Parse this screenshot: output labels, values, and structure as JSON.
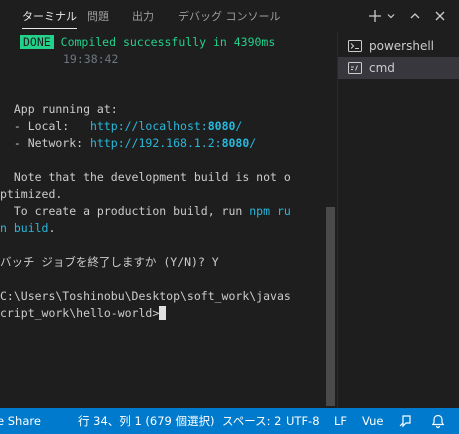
{
  "tabs": [
    {
      "label": "ターミナル",
      "active": true
    },
    {
      "label": "問題"
    },
    {
      "label": "出力"
    },
    {
      "label": "デバッグ コンソール"
    }
  ],
  "toolbar_icons": [
    "plus-icon",
    "chevron-down-icon",
    "chevron-up-icon",
    "close-icon"
  ],
  "terminal": {
    "done_badge": "DONE",
    "compiled_message": "Compiled successfully in 4390ms",
    "time": "19:38:42",
    "app_running": "  App running at:",
    "local_prefix": "  - Local:   ",
    "local_url": "http://localhost:",
    "local_port": "8080",
    "local_suffix": "/",
    "network_prefix": "  - Network: ",
    "network_url": "http://192.168.1.2:",
    "network_port": "8080",
    "network_suffix": "/",
    "note_line1": "  Note that the development build is not o",
    "note_line2": "ptimized.",
    "build_prefix": "  To create a production build, run ",
    "npm_run_1": "npm ru",
    "npm_run_2": "n build",
    "build_suffix": ".",
    "batch_prompt": "バッチ ジョブを終了しますか (Y/N)? Y",
    "path_line1": "C:\\Users\\Toshinobu\\Desktop\\soft_work\\javas",
    "path_line2": "cript_work\\hello-world>"
  },
  "terminals_list": [
    {
      "label": "powershell",
      "icon": "powershell-icon",
      "selected": false
    },
    {
      "label": "cmd",
      "icon": "cmd-icon",
      "selected": true
    }
  ],
  "status_bar": {
    "live_share": "e Share",
    "cursor_position": "行 34、列 1 (679 個選択)",
    "spaces": "スペース: 2",
    "encoding": "UTF-8",
    "eol": "LF",
    "language": "Vue"
  },
  "colors": {
    "background": "#1e1e1e",
    "status_bar": "#007acc",
    "success_green": "#23d18b",
    "link_cyan": "#29b8db"
  }
}
